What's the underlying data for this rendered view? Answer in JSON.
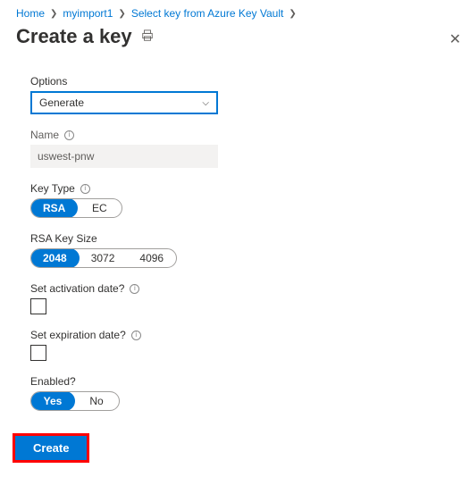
{
  "breadcrumb": {
    "b0": "Home",
    "b1": "myimport1",
    "b2": "Select key from Azure Key Vault"
  },
  "title": "Create a key",
  "form": {
    "options": {
      "label": "Options",
      "value": "Generate"
    },
    "name": {
      "label": "Name",
      "value": "uswest-pnw"
    },
    "keytype": {
      "label": "Key Type",
      "opts": [
        "RSA",
        "EC"
      ],
      "selected": "RSA"
    },
    "rsasize": {
      "label": "RSA Key Size",
      "opts": [
        "2048",
        "3072",
        "4096"
      ],
      "selected": "2048"
    },
    "activation": {
      "label": "Set activation date?"
    },
    "expiration": {
      "label": "Set expiration date?"
    },
    "enabled": {
      "label": "Enabled?",
      "opts": [
        "Yes",
        "No"
      ],
      "selected": "Yes"
    }
  },
  "footer": {
    "create": "Create"
  }
}
